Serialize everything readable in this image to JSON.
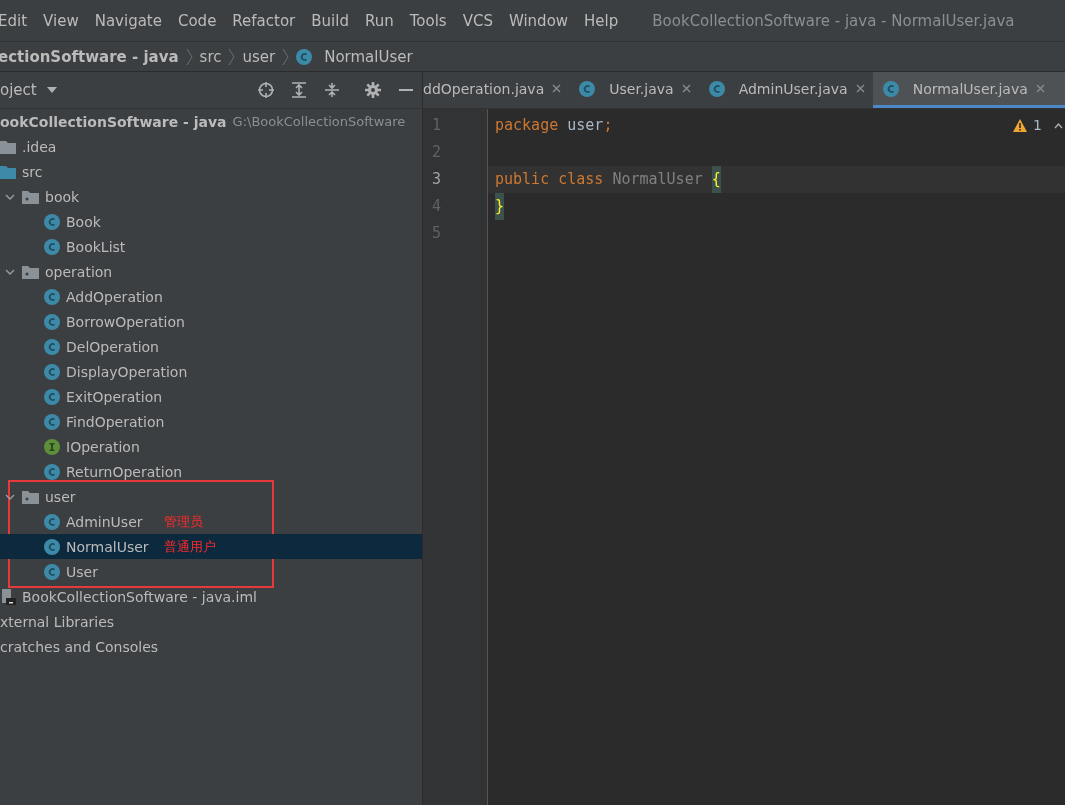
{
  "menu": [
    "Edit",
    "View",
    "Navigate",
    "Code",
    "Refactor",
    "Build",
    "Run",
    "Tools",
    "VCS",
    "Window",
    "Help"
  ],
  "window": {
    "title": "BookCollectionSoftware - java - NormalUser.java"
  },
  "breadcrumb": [
    {
      "label": "ectionSoftware - java",
      "kind": "project"
    },
    {
      "label": "src",
      "kind": "folder"
    },
    {
      "label": "user",
      "kind": "folder"
    },
    {
      "label": "NormalUser",
      "kind": "class"
    }
  ],
  "project_panel": {
    "title": "oject",
    "tree": [
      {
        "name": "ookCollectionSoftware - java",
        "path": "G:\\BookCollectionSoftware",
        "kind": "project",
        "selected": false,
        "children": [
          {
            "name": ".idea",
            "kind": "folder",
            "selected": false
          },
          {
            "name": "src",
            "kind": "source-folder",
            "selected": false,
            "children": [
              {
                "name": "book",
                "kind": "package",
                "expanded": true,
                "selected": false,
                "children": [
                  {
                    "name": "Book",
                    "kind": "class",
                    "selected": false
                  },
                  {
                    "name": "BookList",
                    "kind": "class",
                    "selected": false
                  }
                ]
              },
              {
                "name": "operation",
                "kind": "package",
                "expanded": true,
                "selected": false,
                "children": [
                  {
                    "name": "AddOperation",
                    "kind": "class",
                    "selected": false
                  },
                  {
                    "name": "BorrowOperation",
                    "kind": "class",
                    "selected": false
                  },
                  {
                    "name": "DelOperation",
                    "kind": "class",
                    "selected": false
                  },
                  {
                    "name": "DisplayOperation",
                    "kind": "class",
                    "selected": false
                  },
                  {
                    "name": "ExitOperation",
                    "kind": "class",
                    "selected": false
                  },
                  {
                    "name": "FindOperation",
                    "kind": "class",
                    "selected": false
                  },
                  {
                    "name": "IOperation",
                    "kind": "interface",
                    "selected": false
                  },
                  {
                    "name": "ReturnOperation",
                    "kind": "class",
                    "selected": false
                  }
                ]
              },
              {
                "name": "user",
                "kind": "package",
                "expanded": true,
                "selected": false,
                "children": [
                  {
                    "name": "AdminUser",
                    "kind": "class",
                    "selected": false,
                    "note": "管理员"
                  },
                  {
                    "name": "NormalUser",
                    "kind": "class",
                    "selected": true,
                    "note": "普通用户"
                  },
                  {
                    "name": "User",
                    "kind": "class",
                    "selected": false
                  }
                ]
              }
            ]
          },
          {
            "name": "BookCollectionSoftware - java.iml",
            "kind": "module-file",
            "selected": false
          }
        ]
      },
      {
        "name": "xternal Libraries",
        "kind": "libraries",
        "selected": false
      },
      {
        "name": "cratches and Consoles",
        "kind": "scratches",
        "selected": false
      }
    ]
  },
  "tabs": [
    {
      "label": "ddOperation.java",
      "selected": false
    },
    {
      "label": "User.java",
      "selected": false
    },
    {
      "label": "AdminUser.java",
      "selected": false
    },
    {
      "label": "NormalUser.java",
      "selected": true
    }
  ],
  "editor": {
    "warnings": "1",
    "lines": [
      {
        "number": "1",
        "current": false,
        "tokens": [
          {
            "text": "package",
            "kind": "keyword"
          },
          {
            "text": " user",
            "kind": "ident"
          },
          {
            "text": ";",
            "kind": "keyword"
          }
        ]
      },
      {
        "number": "2",
        "current": false
      },
      {
        "number": "3",
        "current": true,
        "tokens": [
          {
            "text": "public class",
            "kind": "keyword"
          },
          {
            "text": " NormalUser ",
            "kind": "unused"
          },
          {
            "text": "{",
            "kind": "brace"
          }
        ]
      },
      {
        "number": "4",
        "current": false,
        "tokens": [
          {
            "text": "}",
            "kind": "brace"
          }
        ]
      },
      {
        "number": "5",
        "current": false
      }
    ]
  }
}
